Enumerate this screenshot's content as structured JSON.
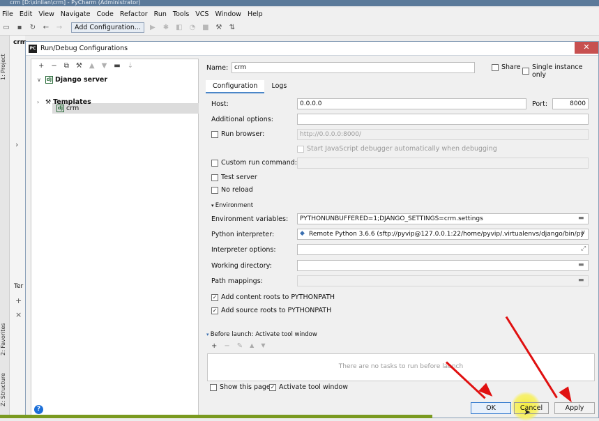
{
  "window_title": "crm [D:\\xinlian\\crm] - PyCharm (Administrator)",
  "menu": [
    "File",
    "Edit",
    "View",
    "Navigate",
    "Code",
    "Refactor",
    "Run",
    "Tools",
    "VCS",
    "Window",
    "Help"
  ],
  "toolbar": {
    "add_configuration": "Add Configuration..."
  },
  "side_tabs": {
    "project": "1: Project",
    "favorites": "2: Favorites",
    "structure": "Z: Structure"
  },
  "background": {
    "project_name": "crm",
    "terminal": "Ter"
  },
  "dialog": {
    "title": "Run/Debug Configurations",
    "tree": {
      "django_server": "Django server",
      "crm": "crm",
      "templates": "Templates"
    },
    "name_label": "Name:",
    "name_value": "crm",
    "share": "Share",
    "single_instance": "Single instance only",
    "tabs": [
      "Configuration",
      "Logs"
    ],
    "host_label": "Host:",
    "host_value": "0.0.0.0",
    "port_label": "Port:",
    "port_value": "8000",
    "additional_options": "Additional options:",
    "run_browser": "Run browser:",
    "run_browser_url": "http://0.0.0.0:8000/",
    "start_js_debugger": "Start JavaScript debugger automatically when debugging",
    "custom_run_command": "Custom run command:",
    "test_server": "Test server",
    "no_reload": "No reload",
    "environment_section": "Environment",
    "env_vars_label": "Environment variables:",
    "env_vars_value": "PYTHONUNBUFFERED=1;DJANGO_SETTINGS=crm.settings",
    "python_interpreter_label": "Python interpreter:",
    "python_interpreter_value": "Remote Python 3.6.6 (sftp://pyvip@127.0.0.1:22/home/pyvip/.virtualenvs/django/bin/py",
    "interpreter_options": "Interpreter options:",
    "working_directory": "Working directory:",
    "path_mappings": "Path mappings:",
    "add_content_roots": "Add content roots to PYTHONPATH",
    "add_source_roots": "Add source roots to PYTHONPATH",
    "before_launch": "Before launch: Activate tool window",
    "no_tasks": "There are no tasks to run before launch",
    "show_this_page": "Show this page",
    "activate_tool_window": "Activate tool window",
    "ok": "OK",
    "cancel": "Cancel",
    "apply": "Apply"
  }
}
